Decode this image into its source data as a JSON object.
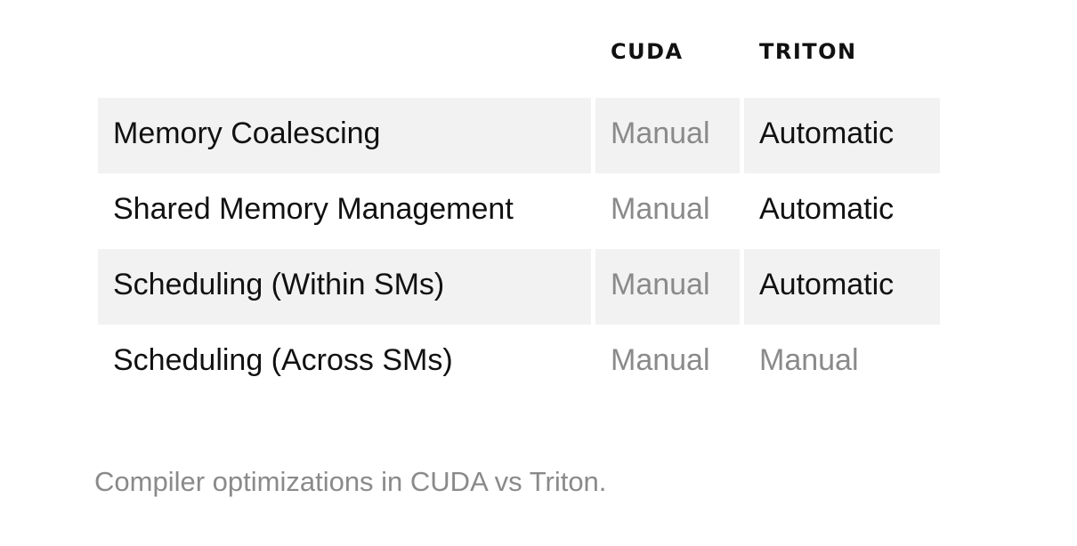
{
  "table": {
    "headers": [
      "",
      "CUDA",
      "TRITON"
    ],
    "rows": [
      {
        "feature": "Memory Coalescing",
        "cuda": "Manual",
        "triton": "Automatic"
      },
      {
        "feature": "Shared Memory Management",
        "cuda": "Manual",
        "triton": "Automatic"
      },
      {
        "feature": "Scheduling (Within SMs)",
        "cuda": "Manual",
        "triton": "Automatic"
      },
      {
        "feature": "Scheduling (Across SMs)",
        "cuda": "Manual",
        "triton": "Manual"
      }
    ]
  },
  "caption": "Compiler optimizations in CUDA vs Triton.",
  "colors": {
    "shaded_row_bg": "#f2f2f2",
    "manual_text": "#8a8a8a",
    "automatic_text": "#111111"
  }
}
